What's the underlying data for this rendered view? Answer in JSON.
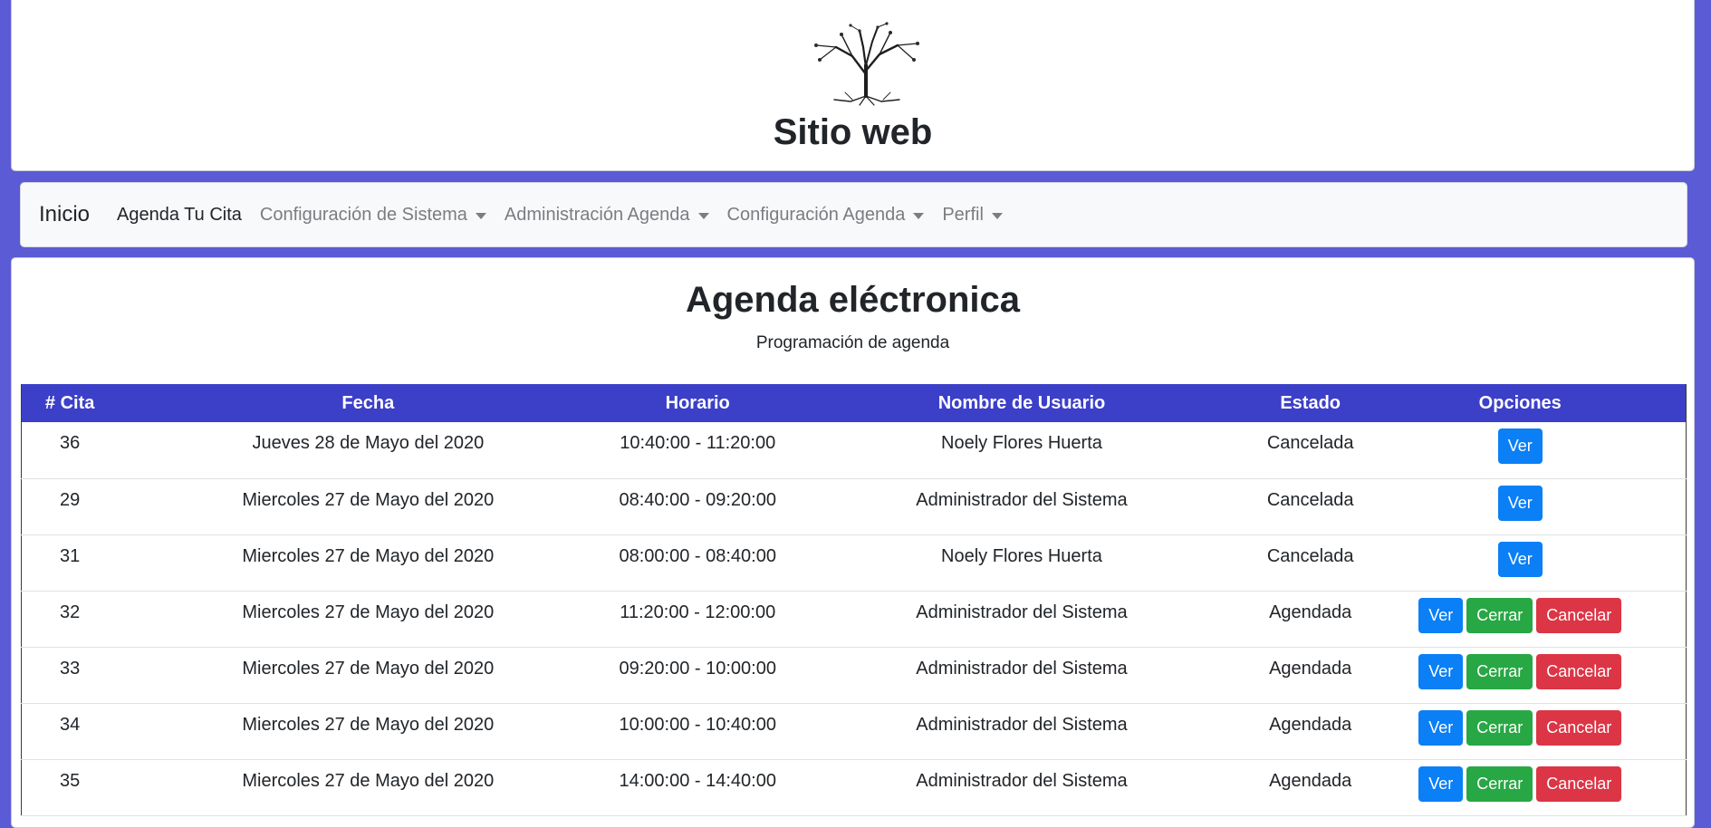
{
  "header": {
    "logo_icon": "tree-logo",
    "site_title": "Sitio web"
  },
  "navbar": {
    "brand": "Inicio",
    "items": [
      {
        "label": "Agenda Tu Cita",
        "dropdown": false,
        "active": true
      },
      {
        "label": "Configuración de Sistema",
        "dropdown": true,
        "active": false
      },
      {
        "label": "Administración Agenda",
        "dropdown": true,
        "active": false
      },
      {
        "label": "Configuración Agenda",
        "dropdown": true,
        "active": false
      },
      {
        "label": "Perfil",
        "dropdown": true,
        "active": false
      }
    ]
  },
  "main": {
    "title": "Agenda eléctronica",
    "subtitle": "Programación de agenda",
    "table": {
      "headers": [
        "# Cita",
        "Fecha",
        "Horario",
        "Nombre de Usuario",
        "Estado",
        "Opciones"
      ],
      "rows": [
        {
          "id": "36",
          "fecha": "Jueves 28 de Mayo del 2020",
          "horario": "10:40:00 - 11:20:00",
          "usuario": "Noely Flores Huerta",
          "estado": "Cancelada",
          "actions": [
            "Ver"
          ]
        },
        {
          "id": "29",
          "fecha": "Miercoles 27 de Mayo del 2020",
          "horario": "08:40:00 - 09:20:00",
          "usuario": "Administrador del Sistema",
          "estado": "Cancelada",
          "actions": [
            "Ver"
          ]
        },
        {
          "id": "31",
          "fecha": "Miercoles 27 de Mayo del 2020",
          "horario": "08:00:00 - 08:40:00",
          "usuario": "Noely Flores Huerta",
          "estado": "Cancelada",
          "actions": [
            "Ver"
          ]
        },
        {
          "id": "32",
          "fecha": "Miercoles 27 de Mayo del 2020",
          "horario": "11:20:00 - 12:00:00",
          "usuario": "Administrador del Sistema",
          "estado": "Agendada",
          "actions": [
            "Ver",
            "Cerrar",
            "Cancelar"
          ]
        },
        {
          "id": "33",
          "fecha": "Miercoles 27 de Mayo del 2020",
          "horario": "09:20:00 - 10:00:00",
          "usuario": "Administrador del Sistema",
          "estado": "Agendada",
          "actions": [
            "Ver",
            "Cerrar",
            "Cancelar"
          ]
        },
        {
          "id": "34",
          "fecha": "Miercoles 27 de Mayo del 2020",
          "horario": "10:00:00 - 10:40:00",
          "usuario": "Administrador del Sistema",
          "estado": "Agendada",
          "actions": [
            "Ver",
            "Cerrar",
            "Cancelar"
          ]
        },
        {
          "id": "35",
          "fecha": "Miercoles 27 de Mayo del 2020",
          "horario": "14:00:00 - 14:40:00",
          "usuario": "Administrador del Sistema",
          "estado": "Agendada",
          "actions": [
            "Ver",
            "Cerrar",
            "Cancelar"
          ]
        }
      ]
    }
  },
  "colors": {
    "page_background": "#5b5bd6",
    "table_header": "#3c3fc8",
    "btn_ver": "#0b7ff5",
    "btn_cerrar": "#28a745",
    "btn_cancelar": "#dc3545"
  }
}
